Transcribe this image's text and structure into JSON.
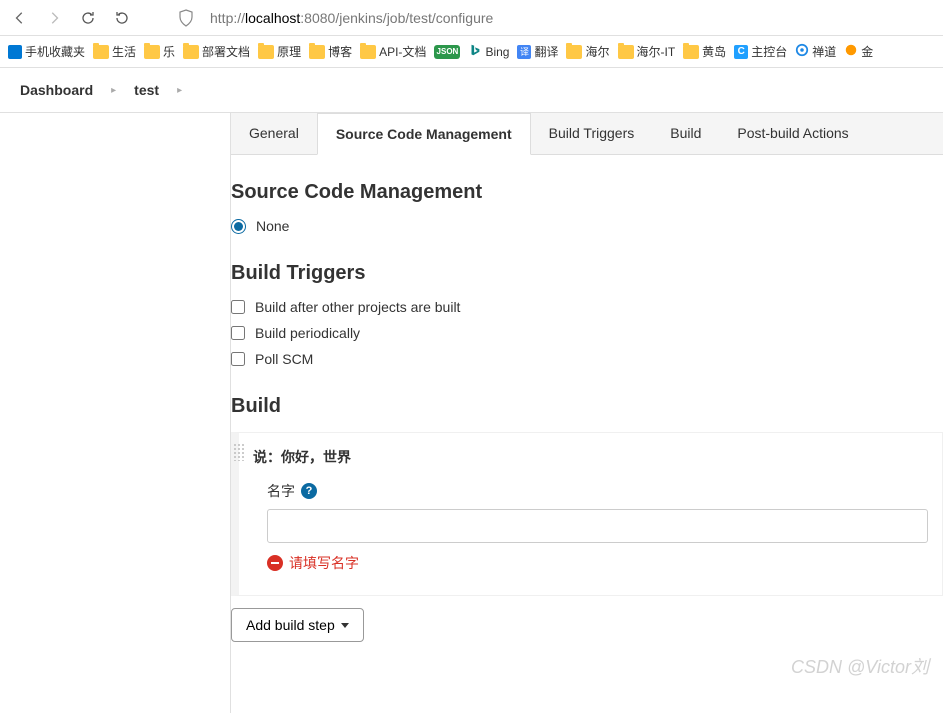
{
  "browser": {
    "url_prefix": "http://",
    "url_host": "localhost",
    "url_path": ":8080/jenkins/job/test/configure"
  },
  "bookmarks": [
    {
      "label": "手机收藏夹",
      "icon": "blue"
    },
    {
      "label": "生活",
      "icon": "folder"
    },
    {
      "label": "乐",
      "icon": "folder"
    },
    {
      "label": "部署文档",
      "icon": "folder"
    },
    {
      "label": "原理",
      "icon": "folder"
    },
    {
      "label": "博客",
      "icon": "folder"
    },
    {
      "label": "API-文档",
      "icon": "folder"
    },
    {
      "label": "JSON",
      "icon": "json"
    },
    {
      "label": "Bing",
      "icon": "bing"
    },
    {
      "label": "翻译",
      "icon": "trans"
    },
    {
      "label": "海尔",
      "icon": "folder"
    },
    {
      "label": "海尔-IT",
      "icon": "folder"
    },
    {
      "label": "黄岛",
      "icon": "folder"
    },
    {
      "label": "主控台",
      "icon": "cube"
    },
    {
      "label": "禅道",
      "icon": "zen"
    },
    {
      "label": "金",
      "icon": "gold"
    }
  ],
  "breadcrumbs": [
    "Dashboard",
    "test"
  ],
  "tabs": [
    {
      "label": "General",
      "active": false
    },
    {
      "label": "Source Code Management",
      "active": true
    },
    {
      "label": "Build Triggers",
      "active": false
    },
    {
      "label": "Build",
      "active": false
    },
    {
      "label": "Post-build Actions",
      "active": false
    }
  ],
  "scm": {
    "title": "Source Code Management",
    "options": [
      {
        "label": "None",
        "checked": true
      }
    ]
  },
  "triggers": {
    "title": "Build Triggers",
    "options": [
      {
        "label": "Build after other projects are built",
        "checked": false
      },
      {
        "label": "Build periodically",
        "checked": false
      },
      {
        "label": "Poll SCM",
        "checked": false
      }
    ]
  },
  "build": {
    "title": "Build",
    "step_title": "说：你好，世界",
    "field_label": "名字",
    "field_value": "",
    "error_text": "请填写名字",
    "add_button": "Add build step"
  },
  "watermark": "CSDN @Victor刘"
}
